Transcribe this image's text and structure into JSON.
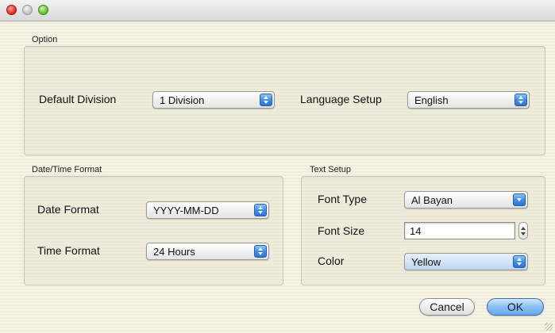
{
  "window": {
    "controls": [
      "close-icon",
      "minimize-icon",
      "zoom-icon"
    ]
  },
  "option": {
    "title": "Option",
    "default_division": {
      "label": "Default Division",
      "value": "1 Division"
    },
    "language_setup": {
      "label": "Language Setup",
      "value": "English"
    }
  },
  "datetime": {
    "title": "Date/Time Format",
    "date_format": {
      "label": "Date Format",
      "value": "YYYY-MM-DD"
    },
    "time_format": {
      "label": "Time Format",
      "value": "24 Hours"
    }
  },
  "text_setup": {
    "title": "Text Setup",
    "font_type": {
      "label": "Font Type",
      "value": "Al Bayan"
    },
    "font_size": {
      "label": "Font Size",
      "value": "14"
    },
    "color": {
      "label": "Color",
      "value": "Yellow"
    }
  },
  "buttons": {
    "cancel": "Cancel",
    "ok": "OK"
  },
  "colors": {
    "accent": "#4a97ea",
    "close": "#d8261a",
    "zoom": "#5fb92c"
  }
}
